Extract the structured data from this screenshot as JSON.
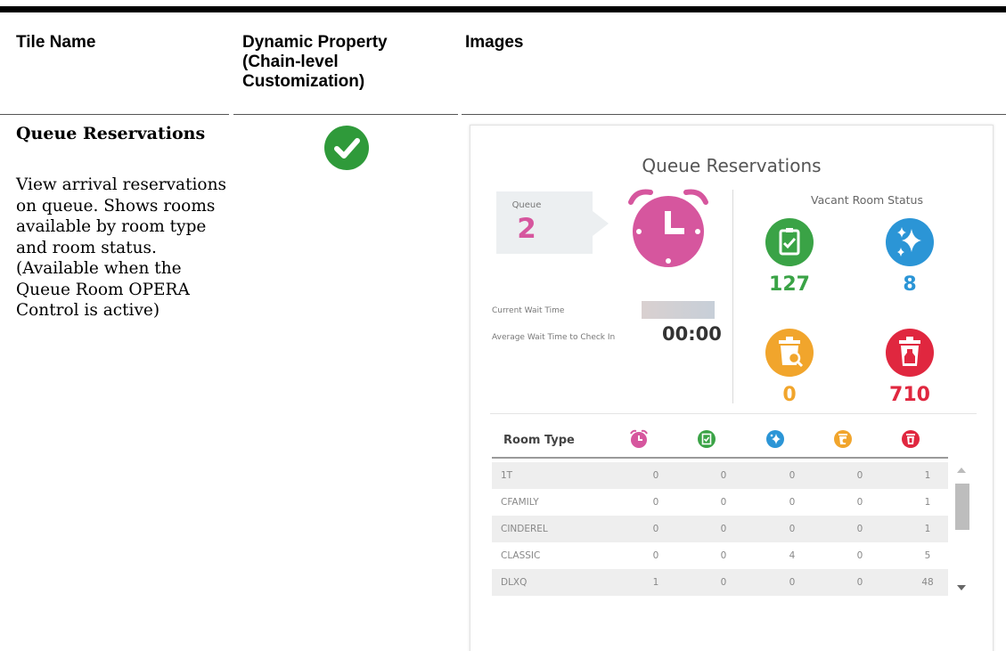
{
  "table": {
    "headers": {
      "tile_name": "Tile Name",
      "dynamic_property": "Dynamic Property (Chain-level Customization)",
      "images": "Images"
    },
    "row": {
      "tile_name": "Queue Reservations",
      "description": "View arrival reservations on queue. Shows rooms available by room type and room status. (Available when the Queue Room OPERA Control is active)",
      "dynamic_property_icon": "check-circle-icon",
      "dynamic_property_color": "#2f9a3a"
    }
  },
  "widget": {
    "title": "Queue Reservations",
    "queue": {
      "label": "Queue",
      "count": "2"
    },
    "queue_icon": "alarm-clock-icon",
    "current_wait_label": "Current Wait Time",
    "average_wait_label": "Average Wait Time to Check In",
    "average_wait_value": "00:00",
    "vacant_status": {
      "title": "Vacant Room Status",
      "items": [
        {
          "icon": "clipboard-check-icon",
          "value": "127",
          "color": "#3aa346"
        },
        {
          "icon": "sparkle-icon",
          "value": "8",
          "color": "#2b95d6"
        },
        {
          "icon": "trash-search-icon",
          "value": "0",
          "color": "#f1a52c"
        },
        {
          "icon": "trash-bottle-icon",
          "value": "710",
          "color": "#e0273f"
        }
      ]
    },
    "room_table": {
      "header": "Room Type",
      "column_icons": [
        "alarm-clock-icon",
        "clipboard-check-icon",
        "sparkle-icon",
        "trash-search-icon",
        "trash-bottle-icon"
      ],
      "rows": [
        {
          "type": "1T",
          "values": [
            "0",
            "0",
            "0",
            "0",
            "1"
          ]
        },
        {
          "type": "CFAMILY",
          "values": [
            "0",
            "0",
            "0",
            "0",
            "1"
          ]
        },
        {
          "type": "CINDEREL",
          "values": [
            "0",
            "0",
            "0",
            "0",
            "1"
          ]
        },
        {
          "type": "CLASSIC",
          "values": [
            "0",
            "0",
            "4",
            "0",
            "5"
          ]
        },
        {
          "type": "DLXQ",
          "values": [
            "1",
            "0",
            "0",
            "0",
            "48"
          ]
        }
      ]
    }
  },
  "colors": {
    "queue_pink": "#d6569e",
    "green": "#3aa346",
    "blue": "#2b95d6",
    "orange": "#f1a52c",
    "red": "#e0273f"
  }
}
